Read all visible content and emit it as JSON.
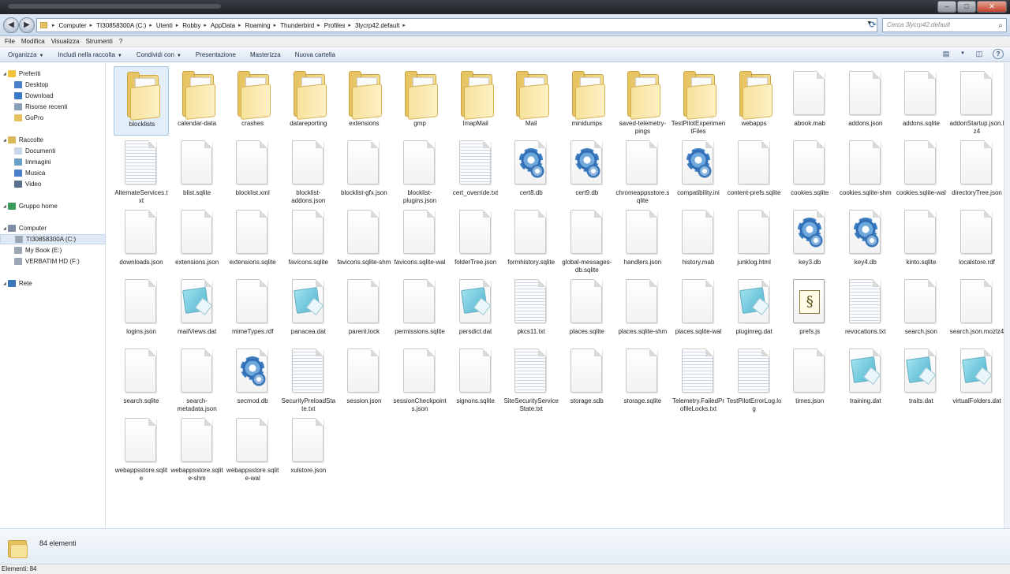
{
  "window": {
    "minimize": "–",
    "maximize": "□",
    "close": "✕"
  },
  "address": {
    "back_icon": "back-arrow-icon",
    "forward_icon": "forward-arrow-icon",
    "crumbs": [
      "Computer",
      "TI30858300A (C:)",
      "Utenti",
      "Robby",
      "AppData",
      "Roaming",
      "Thunderbird",
      "Profiles",
      "3lycrp42.default"
    ],
    "search_placeholder": "Cerca 3lycrp42.default"
  },
  "menu": [
    "File",
    "Modifica",
    "Visualizza",
    "Strumenti",
    "?"
  ],
  "toolbar": {
    "organize": "Organizza",
    "include": "Includi nella raccolta",
    "share": "Condividi con",
    "slideshow": "Presentazione",
    "burn": "Masterizza",
    "new_folder": "Nuova cartella"
  },
  "nav": {
    "favorites_header": "Preferiti",
    "favorites": [
      "Desktop",
      "Download",
      "Risorse recenti",
      "GoPro"
    ],
    "libraries_header": "Raccolte",
    "libraries": [
      "Documenti",
      "Immagini",
      "Musica",
      "Video"
    ],
    "homegroup": "Gruppo home",
    "computer_header": "Computer",
    "drives": [
      "TI30858300A (C:)",
      "My Book (E:)",
      "VERBATIM HD (F:)"
    ],
    "network": "Rete"
  },
  "files": [
    {
      "name": "blocklists",
      "icon": "folder"
    },
    {
      "name": "calendar-data",
      "icon": "folder"
    },
    {
      "name": "crashes",
      "icon": "folder"
    },
    {
      "name": "datareporting",
      "icon": "folder"
    },
    {
      "name": "extensions",
      "icon": "folder"
    },
    {
      "name": "gmp",
      "icon": "folder"
    },
    {
      "name": "ImapMail",
      "icon": "folder"
    },
    {
      "name": "Mail",
      "icon": "folder"
    },
    {
      "name": "minidumps",
      "icon": "folder"
    },
    {
      "name": "saved-telemetry-pings",
      "icon": "folder"
    },
    {
      "name": "TestPilotExperimentFiles",
      "icon": "folder"
    },
    {
      "name": "webapps",
      "icon": "folder"
    },
    {
      "name": "abook.mab",
      "icon": "file"
    },
    {
      "name": "addons.json",
      "icon": "file"
    },
    {
      "name": "addons.sqlite",
      "icon": "file"
    },
    {
      "name": "addonStartup.json.lz4",
      "icon": "file"
    },
    {
      "name": "AlternateServices.txt",
      "icon": "text"
    },
    {
      "name": "blist.sqlite",
      "icon": "file"
    },
    {
      "name": "blocklist.xml",
      "icon": "file"
    },
    {
      "name": "blocklist-addons.json",
      "icon": "file"
    },
    {
      "name": "blocklist-gfx.json",
      "icon": "file"
    },
    {
      "name": "blocklist-plugins.json",
      "icon": "file"
    },
    {
      "name": "cert_override.txt",
      "icon": "text"
    },
    {
      "name": "cert8.db",
      "icon": "gear"
    },
    {
      "name": "cert9.db",
      "icon": "gear"
    },
    {
      "name": "chromeappsstore.sqlite",
      "icon": "file"
    },
    {
      "name": "compatibility.ini",
      "icon": "gear"
    },
    {
      "name": "content-prefs.sqlite",
      "icon": "file"
    },
    {
      "name": "cookies.sqlite",
      "icon": "file"
    },
    {
      "name": "cookies.sqlite-shm",
      "icon": "file"
    },
    {
      "name": "cookies.sqlite-wal",
      "icon": "file"
    },
    {
      "name": "directoryTree.json",
      "icon": "file"
    },
    {
      "name": "downloads.json",
      "icon": "file"
    },
    {
      "name": "extensions.json",
      "icon": "file"
    },
    {
      "name": "extensions.sqlite",
      "icon": "file"
    },
    {
      "name": "favicons.sqlite",
      "icon": "file"
    },
    {
      "name": "favicons.sqlite-shm",
      "icon": "file"
    },
    {
      "name": "favicons.sqlite-wal",
      "icon": "file"
    },
    {
      "name": "folderTree.json",
      "icon": "file"
    },
    {
      "name": "formhistory.sqlite",
      "icon": "file"
    },
    {
      "name": "global-messages-db.sqlite",
      "icon": "file"
    },
    {
      "name": "handlers.json",
      "icon": "file"
    },
    {
      "name": "history.mab",
      "icon": "file"
    },
    {
      "name": "junklog.html",
      "icon": "file"
    },
    {
      "name": "key3.db",
      "icon": "gear"
    },
    {
      "name": "key4.db",
      "icon": "gear"
    },
    {
      "name": "kinto.sqlite",
      "icon": "file"
    },
    {
      "name": "localstore.rdf",
      "icon": "file"
    },
    {
      "name": "logins.json",
      "icon": "file"
    },
    {
      "name": "mailViews.dat",
      "icon": "notepad"
    },
    {
      "name": "mimeTypes.rdf",
      "icon": "file"
    },
    {
      "name": "panacea.dat",
      "icon": "notepad"
    },
    {
      "name": "parent.lock",
      "icon": "file"
    },
    {
      "name": "permissions.sqlite",
      "icon": "file"
    },
    {
      "name": "persdict.dat",
      "icon": "notepad"
    },
    {
      "name": "pkcs11.txt",
      "icon": "text"
    },
    {
      "name": "places.sqlite",
      "icon": "file"
    },
    {
      "name": "places.sqlite-shm",
      "icon": "file"
    },
    {
      "name": "places.sqlite-wal",
      "icon": "file"
    },
    {
      "name": "pluginreg.dat",
      "icon": "notepad"
    },
    {
      "name": "prefs.js",
      "icon": "script"
    },
    {
      "name": "revocations.txt",
      "icon": "text"
    },
    {
      "name": "search.json",
      "icon": "file"
    },
    {
      "name": "search.json.mozlz4",
      "icon": "file"
    },
    {
      "name": "search.sqlite",
      "icon": "file"
    },
    {
      "name": "search-metadata.json",
      "icon": "file"
    },
    {
      "name": "secmod.db",
      "icon": "gear"
    },
    {
      "name": "SecurityPreloadState.txt",
      "icon": "text"
    },
    {
      "name": "session.json",
      "icon": "file"
    },
    {
      "name": "sessionCheckpoints.json",
      "icon": "file"
    },
    {
      "name": "signons.sqlite",
      "icon": "file"
    },
    {
      "name": "SiteSecurityServiceState.txt",
      "icon": "text"
    },
    {
      "name": "storage.sdb",
      "icon": "file"
    },
    {
      "name": "storage.sqlite",
      "icon": "file"
    },
    {
      "name": "Telemetry.FailedProfileLocks.txt",
      "icon": "text"
    },
    {
      "name": "TestPilotErrorLog.log",
      "icon": "text"
    },
    {
      "name": "times.json",
      "icon": "file"
    },
    {
      "name": "training.dat",
      "icon": "notepad"
    },
    {
      "name": "traits.dat",
      "icon": "notepad"
    },
    {
      "name": "virtualFolders.dat",
      "icon": "notepad"
    },
    {
      "name": "webappsstore.sqlite",
      "icon": "file"
    },
    {
      "name": "webappsstore.sqlite-shm",
      "icon": "file"
    },
    {
      "name": "webappsstore.sqlite-wal",
      "icon": "file"
    },
    {
      "name": "xulstore.json",
      "icon": "file"
    }
  ],
  "details": {
    "count": "84 elementi"
  },
  "status": {
    "text": "Elementi: 84"
  }
}
